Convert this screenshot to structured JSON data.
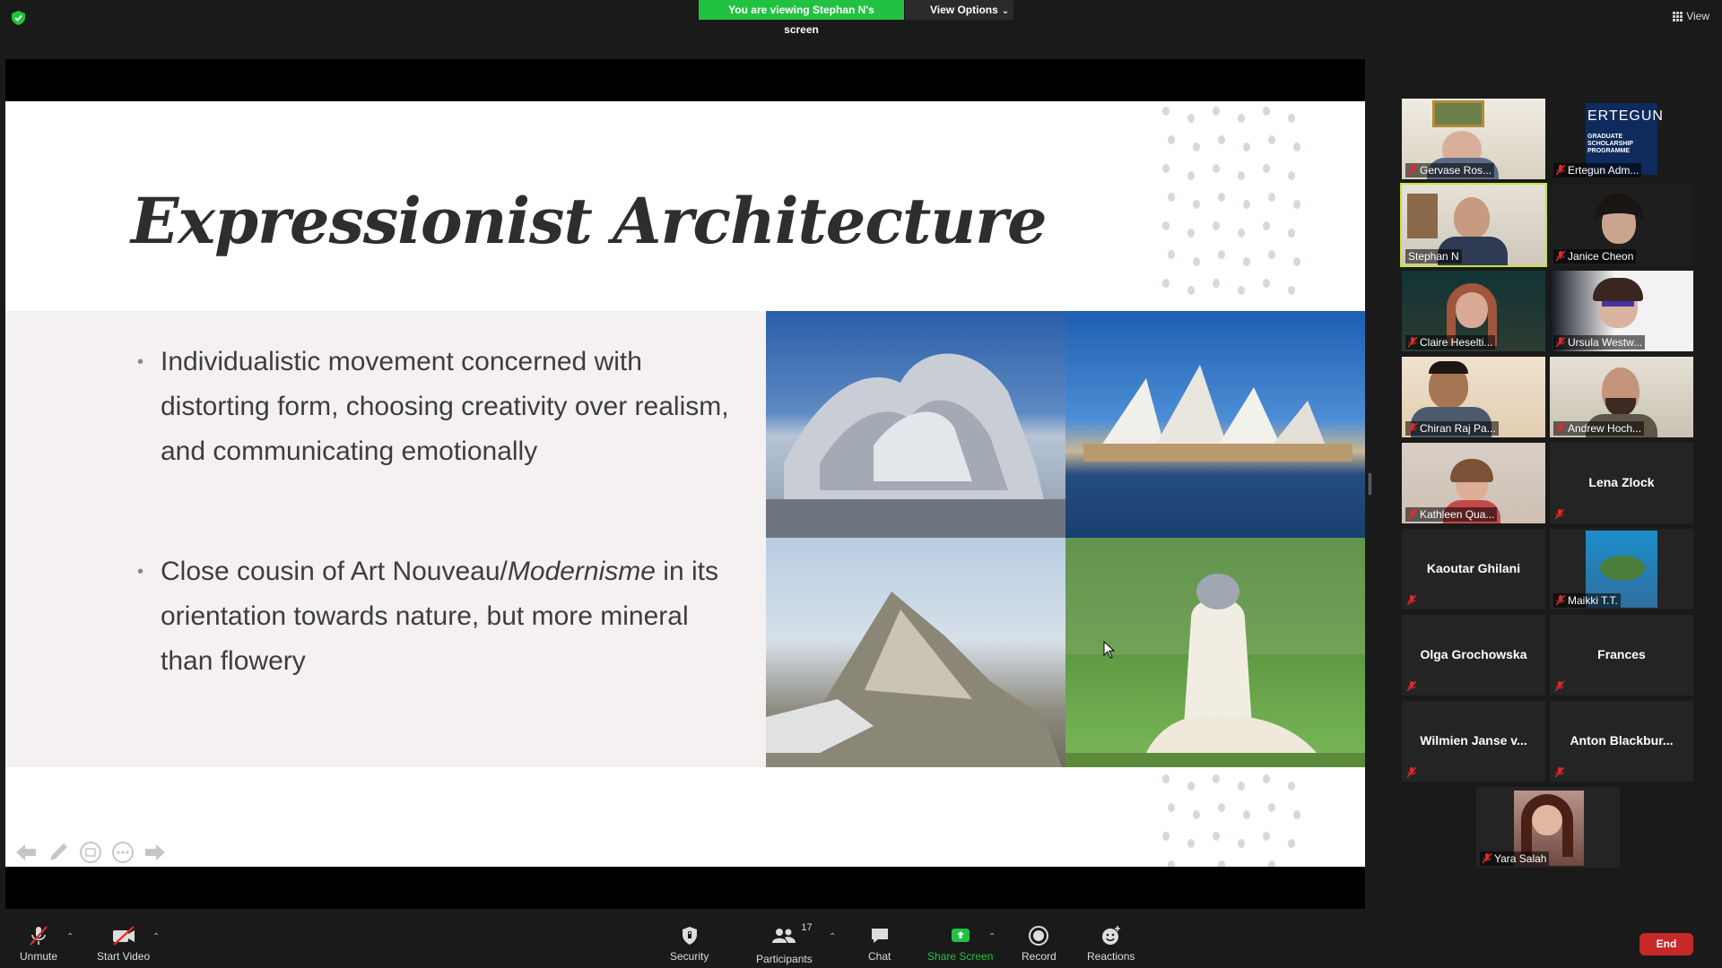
{
  "banner": {
    "viewing_text": "You are viewing Stephan N's screen",
    "view_options_label": "View Options"
  },
  "top_right": {
    "view_label": "View"
  },
  "slide": {
    "title": "Expressionist Architecture",
    "bullet1": "Individualistic movement concerned with distorting form, choosing creativity over realism, and communicating emotionally",
    "bullet2_prefix": "Close cousin of Art Nouveau/",
    "bullet2_italic": "Modernisme",
    "bullet2_suffix": " in its orientation towards nature, but more mineral than flowery"
  },
  "gallery": {
    "participants": [
      {
        "name": "Gervase Ros...",
        "video": true,
        "muted": true
      },
      {
        "name": "Ertegun Adm...",
        "video": true,
        "muted": true,
        "logo_text": "ERTEGUN",
        "logo_sub": "GRADUATE SCHOLARSHIP PROGRAMME"
      },
      {
        "name": "Stephan N",
        "video": true,
        "muted": false,
        "speaking": true
      },
      {
        "name": "Janice Cheon",
        "video": true,
        "muted": true
      },
      {
        "name": "Claire Heselti...",
        "video": true,
        "muted": true
      },
      {
        "name": "Ursula Westw...",
        "video": true,
        "muted": true
      },
      {
        "name": "Chiran Raj Pa...",
        "video": true,
        "muted": true
      },
      {
        "name": "Andrew Hoch...",
        "video": true,
        "muted": true
      },
      {
        "name": "Kathleen Qua...",
        "video": true,
        "muted": true
      },
      {
        "name": "Lena Zlock",
        "video": false,
        "muted": true
      },
      {
        "name": "Kaoutar Ghilani",
        "video": false,
        "muted": true
      },
      {
        "name": "Maikki T.T.",
        "video": true,
        "muted": true
      },
      {
        "name": "Olga Grochowska",
        "video": false,
        "muted": true
      },
      {
        "name": "Frances",
        "video": false,
        "muted": true
      },
      {
        "name": "Wilmien Janse v...",
        "video": false,
        "muted": true
      },
      {
        "name": "Anton  Blackbur...",
        "video": false,
        "muted": true
      },
      {
        "name": "Yara Salah",
        "video": true,
        "muted": true
      }
    ]
  },
  "toolbar": {
    "unmute": "Unmute",
    "start_video": "Start Video",
    "security": "Security",
    "participants": "Participants",
    "participants_count": "17",
    "chat": "Chat",
    "share_screen": "Share Screen",
    "record": "Record",
    "reactions": "Reactions",
    "end": "End"
  },
  "colors": {
    "banner_green": "#23c142",
    "end_red": "#c72828",
    "speaking_outline": "#c6e53a"
  }
}
